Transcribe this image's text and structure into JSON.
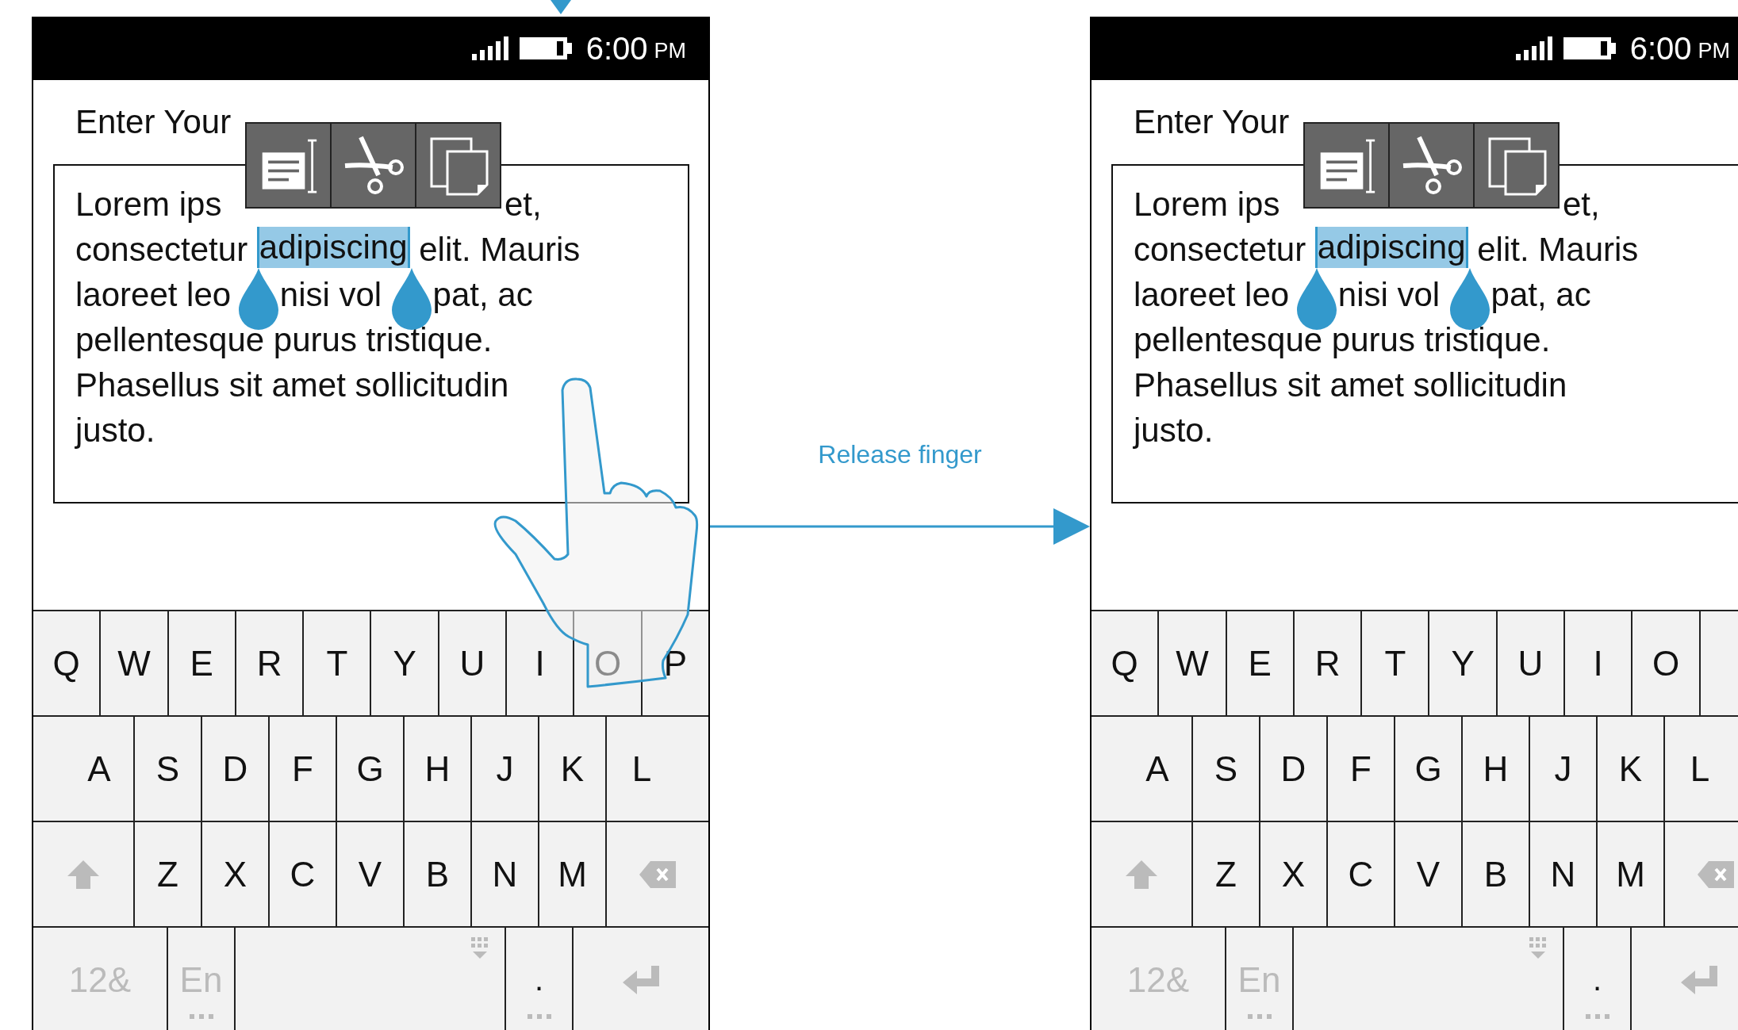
{
  "phones": [
    {
      "status_bar": {
        "time": "6:00",
        "ampm": "PM"
      },
      "title": "Enter Your",
      "finger_on_screen": true,
      "text_lines": [
        [
          {
            "kind": "plain",
            "text": "Lorem ips",
            "selected": false
          },
          {
            "kind": "after_toolbar",
            "text": "et,",
            "selected": false
          }
        ],
        [
          {
            "kind": "plain",
            "text": "consectetur ",
            "selected": false
          },
          {
            "kind": "plain",
            "text": "adipiscing",
            "selected": true
          },
          {
            "kind": "plain",
            "text": " elit. Mauris",
            "selected": false
          }
        ],
        [
          {
            "kind": "plain",
            "text": "laoreet leo",
            "selected": false
          },
          {
            "kind": "after_handle",
            "text": "nisi vol",
            "selected": false
          },
          {
            "kind": "after_handle",
            "text": "pat, ac",
            "selected": false
          }
        ],
        [
          {
            "kind": "plain",
            "text": "pellentesque purus tristique.",
            "selected": false
          }
        ],
        [
          {
            "kind": "plain",
            "text": "Phasellus sit amet sollicitudin",
            "selected": false
          }
        ],
        [
          {
            "kind": "plain",
            "text": "justo.",
            "selected": false
          }
        ]
      ],
      "keyboard": [
        [
          {
            "kind": "letter",
            "label": "Q"
          },
          {
            "kind": "letter",
            "label": "W"
          },
          {
            "kind": "letter",
            "label": "E"
          },
          {
            "kind": "letter",
            "label": "R"
          },
          {
            "kind": "letter",
            "label": "T"
          },
          {
            "kind": "letter",
            "label": "Y"
          },
          {
            "kind": "letter",
            "label": "U"
          },
          {
            "kind": "letter",
            "label": "I"
          },
          {
            "kind": "letter",
            "label": "O"
          },
          {
            "kind": "letter",
            "label": "P"
          }
        ],
        [
          {
            "kind": "edge_letter",
            "label": "A"
          },
          {
            "kind": "letter",
            "label": "S"
          },
          {
            "kind": "letter",
            "label": "D"
          },
          {
            "kind": "letter",
            "label": "F"
          },
          {
            "kind": "letter",
            "label": "G"
          },
          {
            "kind": "letter",
            "label": "H"
          },
          {
            "kind": "letter",
            "label": "J"
          },
          {
            "kind": "letter",
            "label": "K"
          },
          {
            "kind": "edge_letter",
            "label": "L"
          }
        ],
        [
          {
            "kind": "shift"
          },
          {
            "kind": "letter",
            "label": "Z"
          },
          {
            "kind": "letter",
            "label": "X"
          },
          {
            "kind": "letter",
            "label": "C"
          },
          {
            "kind": "letter",
            "label": "V"
          },
          {
            "kind": "letter",
            "label": "B"
          },
          {
            "kind": "letter",
            "label": "N"
          },
          {
            "kind": "letter",
            "label": "M"
          },
          {
            "kind": "backspace"
          }
        ],
        [
          {
            "kind": "mode",
            "label": "12&"
          },
          {
            "kind": "language",
            "label": "En"
          },
          {
            "kind": "space"
          },
          {
            "kind": "punct",
            "label": "."
          },
          {
            "kind": "enter"
          }
        ]
      ]
    },
    {
      "status_bar": {
        "time": "6:00",
        "ampm": "PM"
      },
      "title": "Enter Your",
      "finger_on_screen": false,
      "text_lines": [
        [
          {
            "kind": "plain",
            "text": "Lorem ips",
            "selected": false
          },
          {
            "kind": "after_toolbar",
            "text": "et,",
            "selected": false
          }
        ],
        [
          {
            "kind": "plain",
            "text": "consectetur ",
            "selected": false
          },
          {
            "kind": "plain",
            "text": "adipiscing",
            "selected": true
          },
          {
            "kind": "plain",
            "text": " elit. Mauris",
            "selected": false
          }
        ],
        [
          {
            "kind": "plain",
            "text": "laoreet leo",
            "selected": false
          },
          {
            "kind": "after_handle",
            "text": "nisi vol",
            "selected": false
          },
          {
            "kind": "after_handle",
            "text": "pat, ac",
            "selected": false
          }
        ],
        [
          {
            "kind": "plain",
            "text": "pellentesque purus tristique.",
            "selected": false
          }
        ],
        [
          {
            "kind": "plain",
            "text": "Phasellus sit amet sollicitudin",
            "selected": false
          }
        ],
        [
          {
            "kind": "plain",
            "text": "justo.",
            "selected": false
          }
        ]
      ],
      "keyboard": [
        [
          {
            "kind": "letter",
            "label": "Q"
          },
          {
            "kind": "letter",
            "label": "W"
          },
          {
            "kind": "letter",
            "label": "E"
          },
          {
            "kind": "letter",
            "label": "R"
          },
          {
            "kind": "letter",
            "label": "T"
          },
          {
            "kind": "letter",
            "label": "Y"
          },
          {
            "kind": "letter",
            "label": "U"
          },
          {
            "kind": "letter",
            "label": "I"
          },
          {
            "kind": "letter",
            "label": "O"
          },
          {
            "kind": "blank"
          }
        ],
        [
          {
            "kind": "edge_letter",
            "label": "A"
          },
          {
            "kind": "letter",
            "label": "S"
          },
          {
            "kind": "letter",
            "label": "D"
          },
          {
            "kind": "letter",
            "label": "F"
          },
          {
            "kind": "letter",
            "label": "G"
          },
          {
            "kind": "letter",
            "label": "H"
          },
          {
            "kind": "letter",
            "label": "J"
          },
          {
            "kind": "letter",
            "label": "K"
          },
          {
            "kind": "edge_letter",
            "label": "L"
          }
        ],
        [
          {
            "kind": "shift"
          },
          {
            "kind": "letter",
            "label": "Z"
          },
          {
            "kind": "letter",
            "label": "X"
          },
          {
            "kind": "letter",
            "label": "C"
          },
          {
            "kind": "letter",
            "label": "V"
          },
          {
            "kind": "letter",
            "label": "B"
          },
          {
            "kind": "letter",
            "label": "N"
          },
          {
            "kind": "letter",
            "label": "M"
          },
          {
            "kind": "backspace"
          }
        ],
        [
          {
            "kind": "mode",
            "label": "12&"
          },
          {
            "kind": "language",
            "label": "En"
          },
          {
            "kind": "space"
          },
          {
            "kind": "punct",
            "label": "."
          },
          {
            "kind": "enter"
          }
        ]
      ]
    }
  ],
  "transition": {
    "label": "Release finger"
  }
}
